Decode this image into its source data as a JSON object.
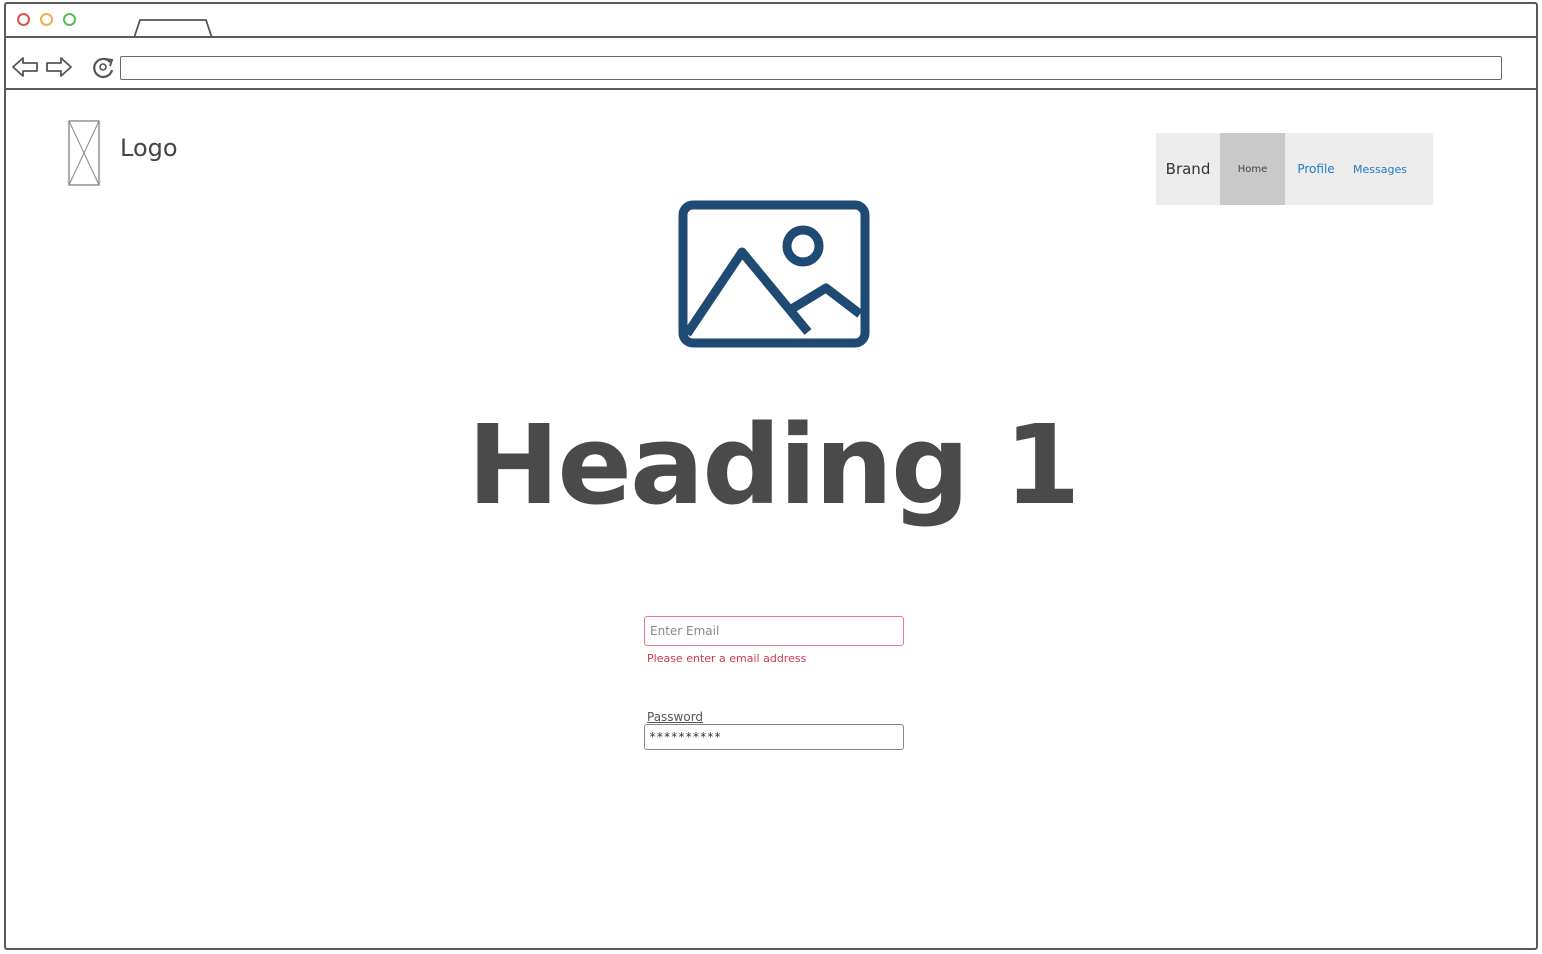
{
  "browser": {
    "address_value": "",
    "icons": {
      "back": "arrow-left-icon",
      "forward": "arrow-right-icon",
      "reload": "reload-icon"
    }
  },
  "header": {
    "logo_label": "Logo",
    "nav": {
      "brand": "Brand",
      "items": [
        "Home",
        "Profile",
        "Messages"
      ],
      "active": "Home"
    }
  },
  "main": {
    "heading": "Heading 1",
    "email": {
      "placeholder": "Enter Email",
      "value": "",
      "error": "Please enter a email address"
    },
    "password": {
      "label": "Password",
      "value": "**********"
    }
  },
  "colors": {
    "accent_link": "#1f7ac6",
    "image_icon": "#1f4a73",
    "error": "#d0394b",
    "nav_bg": "#ececec",
    "nav_active_bg": "#c9c9c9"
  }
}
